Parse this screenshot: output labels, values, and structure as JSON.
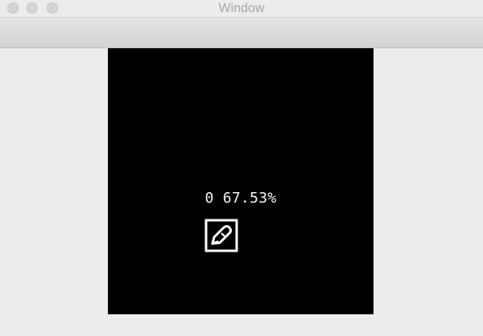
{
  "window": {
    "title": "Window"
  },
  "viewport": {
    "readout": "0 67.53%",
    "icon": "edit-icon"
  },
  "colors": {
    "background": "#ececec",
    "canvas": "#000000",
    "foreground": "#f5f5f5"
  }
}
